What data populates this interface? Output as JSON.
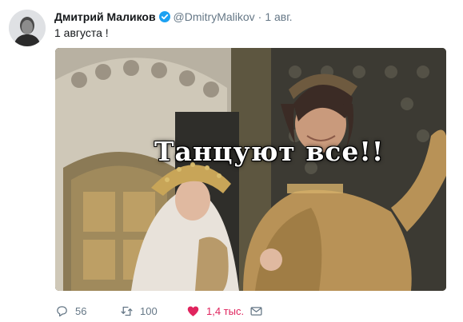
{
  "tweet": {
    "author_name": "Дмитрий Маликов",
    "handle": "@DmitryMalikov",
    "separator": "·",
    "time": "1 авг.",
    "text": "1 августа !",
    "image_caption": "Танцуют все!!"
  },
  "actions": {
    "reply_count": "56",
    "retweet_count": "100",
    "like_count": "1,4 тыс."
  },
  "colors": {
    "verified": "#1da1f2",
    "like": "#e0245e",
    "secondary_text": "#657786"
  }
}
